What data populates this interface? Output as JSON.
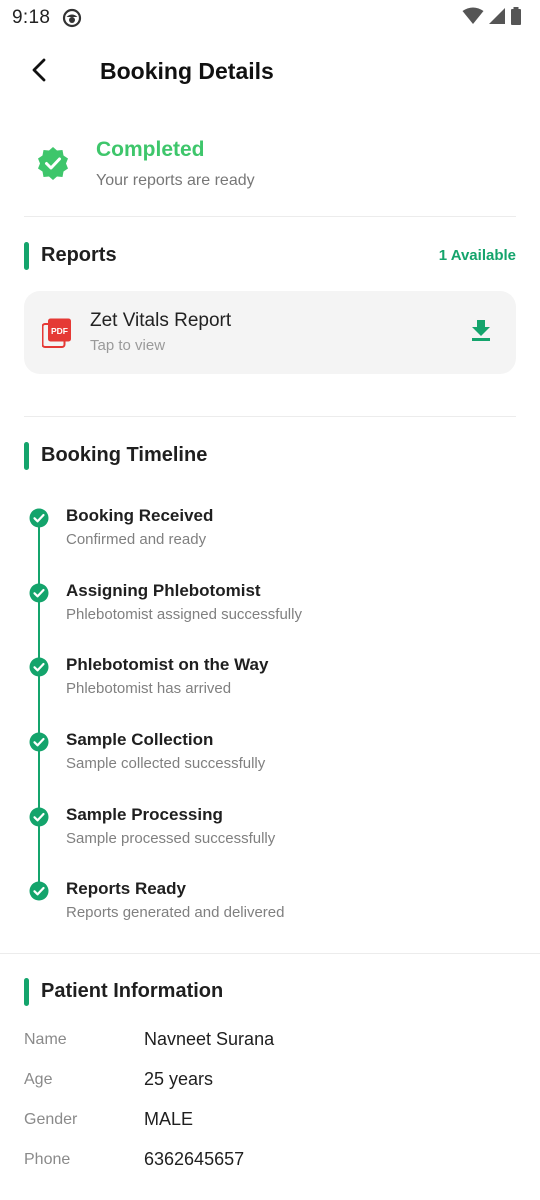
{
  "status_bar": {
    "time": "9:18"
  },
  "header": {
    "title": "Booking Details"
  },
  "booking_status": {
    "title": "Completed",
    "subtitle": "Your reports are ready",
    "color": "#3ec66b"
  },
  "reports": {
    "section_title": "Reports",
    "badge": "1 Available",
    "items": [
      {
        "name": "Zet Vitals Report",
        "hint": "Tap to view",
        "icon": "pdf-icon",
        "action_icon": "download-icon"
      }
    ]
  },
  "timeline": {
    "section_title": "Booking Timeline",
    "steps": [
      {
        "title": "Booking Received",
        "subtitle": "Confirmed and ready"
      },
      {
        "title": "Assigning Phlebotomist",
        "subtitle": "Phlebotomist assigned successfully"
      },
      {
        "title": "Phlebotomist on the Way",
        "subtitle": "Phlebotomist has arrived"
      },
      {
        "title": "Sample Collection",
        "subtitle": "Sample collected successfully"
      },
      {
        "title": "Sample Processing",
        "subtitle": "Sample processed successfully"
      },
      {
        "title": "Reports Ready",
        "subtitle": "Reports generated and delivered"
      }
    ]
  },
  "patient": {
    "section_title": "Patient Information",
    "fields": [
      {
        "label": "Name",
        "value": "Navneet Surana"
      },
      {
        "label": "Age",
        "value": "25 years"
      },
      {
        "label": "Gender",
        "value": "MALE"
      },
      {
        "label": "Phone",
        "value": "6362645657"
      }
    ]
  },
  "colors": {
    "accent": "#14a46c",
    "success": "#3ec66b",
    "pdf": "#e53935"
  }
}
